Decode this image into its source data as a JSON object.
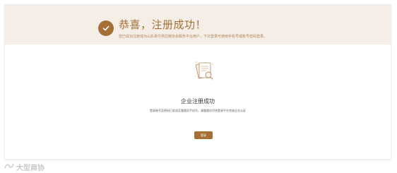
{
  "banner": {
    "icon": "check-icon",
    "title": "恭喜，注册成功！",
    "description": "您已成功注册成为山东易付供应链协会服务平台用户，下次登录可使用手机号或账号密码登录。"
  },
  "main": {
    "illustration_icon": "document-search-icon",
    "title": "企业注册成功",
    "description": "登录账号及密码已发送至管理员手机号，请管理员尽快登录平台完成企业认证",
    "login_button": "登录"
  },
  "watermark": {
    "icon": "logo-icon",
    "text": "大型商协"
  },
  "colors": {
    "accent": "#a66f35",
    "banner_bg": "#f4eee6",
    "title_text": "#333333",
    "desc_text": "#555555"
  }
}
